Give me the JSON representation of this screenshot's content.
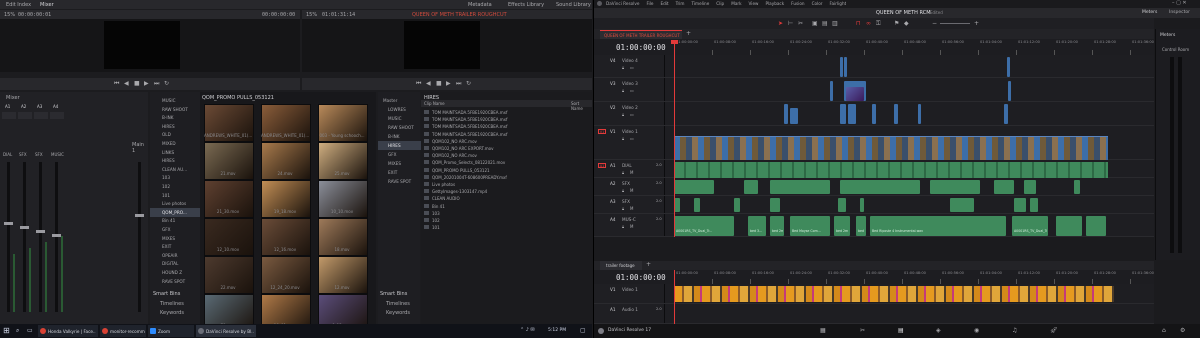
{
  "left": {
    "edit_index_tab": "Edit Index",
    "mixer_tab": "Mixer",
    "metadata_tab": "Metadata",
    "effects_library_tab": "Effects Library",
    "sound_library_tab": "Sound Library",
    "src_zoom": "15%",
    "src_timecode": "00:00:00:01",
    "src_timecode_right": "00:00:00:00",
    "prog_zoom": "15%",
    "prog_timecode": "01:01:31:14",
    "prog_title": "QUEEN OF METH TRAILER ROUGHCUT",
    "mixer_label": "Mixer",
    "channels": [
      "A1",
      "A2",
      "A3",
      "A4"
    ],
    "channel_names": [
      "DIAL",
      "SFX",
      "SFX",
      "MUSIC"
    ],
    "main_label": "Main 1",
    "bins_a": [
      "MUSIC",
      "RAW SHOOT",
      "B-INK",
      "HIRES",
      "OLD",
      "MIXED",
      "LINKS",
      "HIRES",
      "CLEAN AU...",
      "103",
      "102",
      "101",
      "Live photos",
      "QOM_PRO...",
      "Bin 41",
      "GFX",
      "MIXES",
      "EXIT",
      "OPEAIR",
      "DIGITAL",
      "HOUND Z",
      "RAVE SPOT"
    ],
    "smart_bins_a": "Smart Bins",
    "smart_items_a": [
      "Timelines",
      "Keywords"
    ],
    "media_bin_title": "QOM_PROMO PULLS_053121",
    "thumb_captions": [
      "ANDREWS_WHITE_01(...",
      "ANDREWS_WHITE_01(...",
      "003 - Young schooch...",
      "21.mov",
      "24.mov",
      "25.mov",
      "21_30.mov",
      "19_18.mov",
      "10_10.mov",
      "12_10.mov",
      "12_16.mov",
      "18.mov",
      "22.mov",
      "12_24_20.mov",
      "12.mov",
      "70.mov",
      "19_01.mov",
      "9_12.mov"
    ],
    "bins_b": [
      "Master",
      "LOWRES",
      "MUSIC",
      "RAW SHOOT",
      "B-INK",
      "HIRES",
      "GFX",
      "MIXES",
      "EXIT",
      "RAVE SPOT"
    ],
    "smart_bins_b": "Smart Bins",
    "smart_items_b": [
      "Timelines",
      "Keywords"
    ],
    "list_bin_title": "HIRES",
    "list_col_name": "Clip Name",
    "list_sort": "Sort Name",
    "files": [
      "TOM MAINTSADA.5FBE1920CBEA.mxf",
      "TOM MAINTSADA.5FBE1920CBEA.mxf",
      "TOM MAINTSADA.5FBE1920CBEA.mxf",
      "TOM MAINTSADA.5FBE1920CBEA.mxf",
      "QOM102_NO ARC.mov",
      "QOM102_NO ARC EXPORT.mov",
      "QOM102_NO ARC.mov",
      "QOM_Promo_Selects_08122021.mov",
      "QOM_PROMO PULLS_053121",
      "QOM_20201004T-608600PREADY.mxf",
      "Live photos",
      "GettyImages-1303147.mp4",
      "CLEAN AUDIO",
      "Bin 41",
      "103",
      "102",
      "101"
    ]
  },
  "taskbar": {
    "time": "5:12 PM",
    "apps": [
      "Honda Valkyrie | Face...",
      "monitor-recommend...",
      "Zoom",
      "DaVinci Resolve by Bl..."
    ]
  },
  "right": {
    "menu": [
      "DaVinci Resolve",
      "File",
      "Edit",
      "Trim",
      "Timeline",
      "Clip",
      "Mark",
      "View",
      "Playback",
      "Fusion",
      "Color",
      "Fairlight",
      "Workspace",
      "Help"
    ],
    "project_title": "QUEEN OF METH RCM",
    "project_status": "Edited",
    "meters_tab": "Meters",
    "inspector_tab": "Inspector",
    "timeline_name": "QUEEN OF METH TRAILER ROUGHCUT",
    "timecode": "01:00:00:00",
    "ruler": [
      "01:00:00:00",
      "01:00:08:00",
      "01:00:16:00",
      "01:00:24:00",
      "01:00:32:00",
      "01:00:40:00",
      "01:00:48:00",
      "01:00:56:00",
      "01:01:04:00",
      "01:01:12:00",
      "01:01:20:00",
      "01:01:28:00",
      "01:01:36:00"
    ],
    "video_tracks": [
      {
        "id": "V4",
        "name": "Video 4"
      },
      {
        "id": "V3",
        "name": "Video 3"
      },
      {
        "id": "V2",
        "name": "Video 2"
      },
      {
        "id": "V1",
        "name": "Video 1"
      }
    ],
    "audio_tracks": [
      {
        "id": "A1",
        "name": "DIAL",
        "ch": "2.0"
      },
      {
        "id": "A2",
        "name": "SFX",
        "ch": "2.0"
      },
      {
        "id": "A3",
        "name": "SFX",
        "ch": "2.0"
      },
      {
        "id": "A4",
        "name": "MUS-C",
        "ch": "2.0"
      }
    ],
    "clip_labels_a4": [
      "A0001RS_TV_Dual_Tr...",
      "bed 3...",
      "bed 2m",
      "Bed Moyse Com...",
      "bed 2m",
      "bed 3m",
      "Bed Riposte 4 Instrumental.wav",
      "A0001RS_TV_Dual_Tr..."
    ],
    "meters_label": "Meters",
    "control_room": "Control Room",
    "lower_timeline_name": "trailer footage",
    "lower_timecode": "01:00:00:00",
    "lower_tracks": [
      {
        "id": "V1",
        "name": "Video 1"
      },
      {
        "id": "A1",
        "name": "Audio 1",
        "ch": "2.0"
      }
    ],
    "app_name": "DaVinci Resolve 17",
    "colors": {
      "accent_red": "#e23a3a",
      "video_clip": "#3d6ea8",
      "audio_clip": "#3f8a5c",
      "orange_clip": "#e59a1f"
    }
  }
}
